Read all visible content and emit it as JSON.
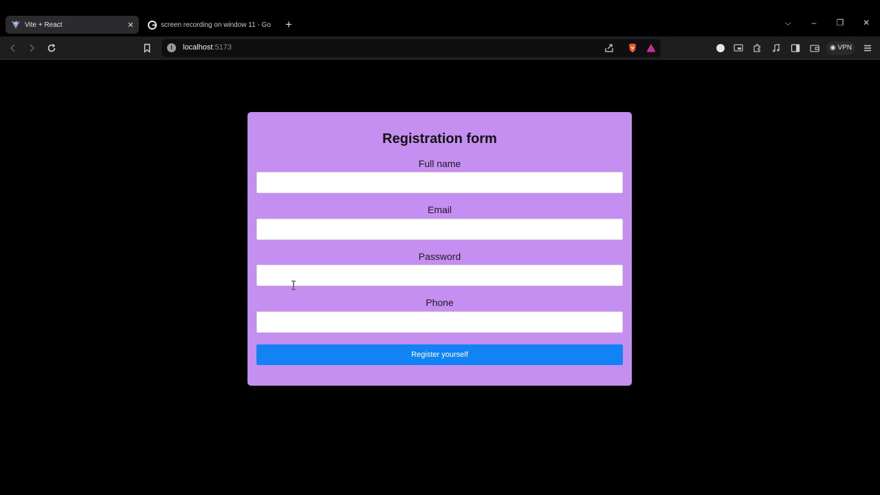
{
  "browser": {
    "tabs": [
      {
        "title": "Vite + React",
        "active": true
      },
      {
        "title": "screen recording on window 11 - Go",
        "active": false
      }
    ],
    "new_tab": "+",
    "address": {
      "host": "localhost",
      "port": ":5173"
    },
    "vpn_label": "VPN",
    "window_controls": {
      "dropdown": "⌵",
      "minimize": "–",
      "restore": "❐",
      "close": "✕"
    }
  },
  "form": {
    "title": "Registration form",
    "fields": [
      {
        "label": "Full name",
        "value": ""
      },
      {
        "label": "Email",
        "value": ""
      },
      {
        "label": "Password",
        "value": ""
      },
      {
        "label": "Phone",
        "value": ""
      }
    ],
    "submit_label": "Register yourself"
  },
  "colors": {
    "card_bg": "#c58ef1",
    "button_bg": "#1183f5",
    "page_bg": "#000000"
  }
}
